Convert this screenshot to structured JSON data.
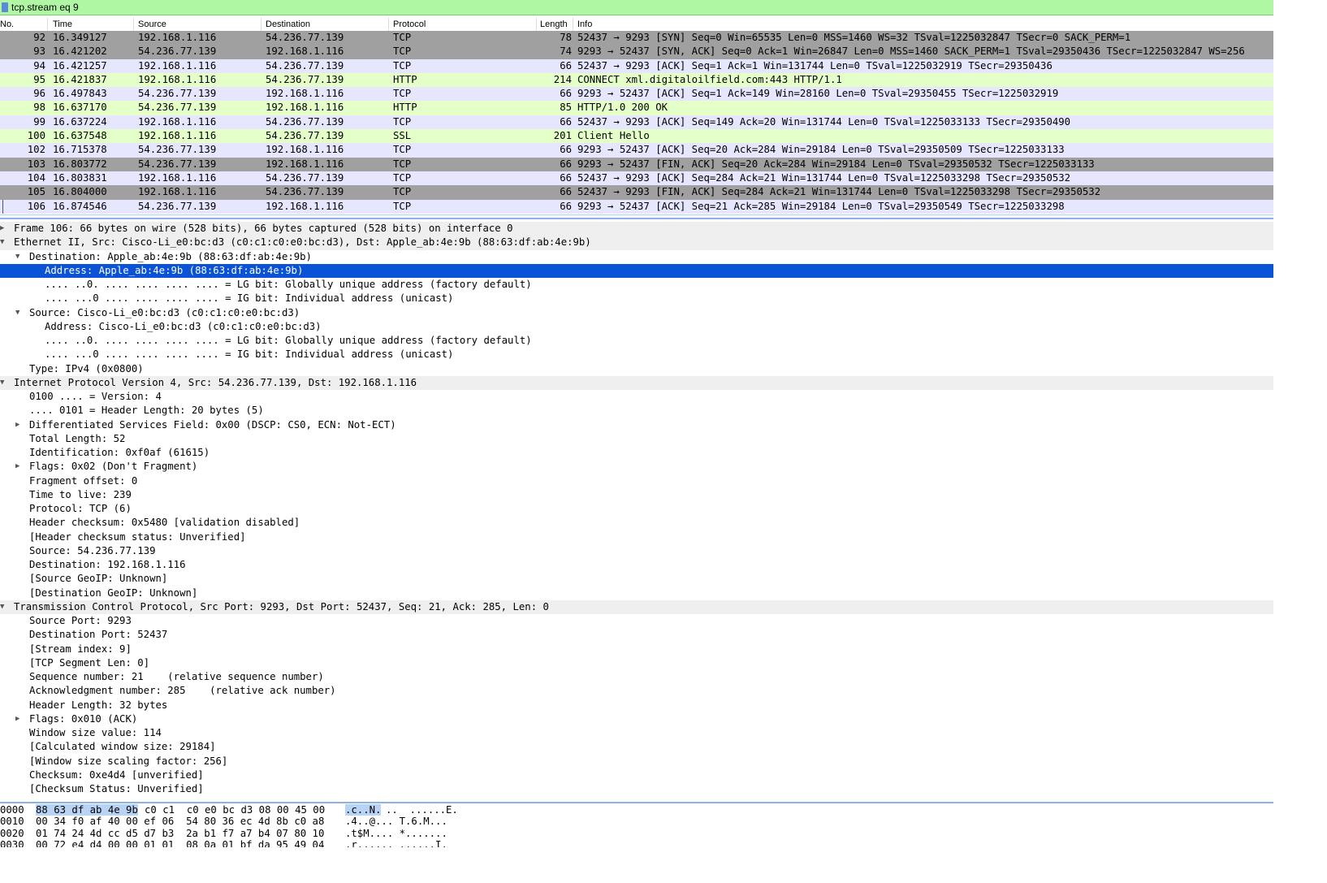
{
  "filter": {
    "value": "tcp.stream eq 9"
  },
  "columns": {
    "no": "No.",
    "time": "Time",
    "source": "Source",
    "destination": "Destination",
    "protocol": "Protocol",
    "length": "Length",
    "info": "Info"
  },
  "colors": {
    "tcp_row": "#e7e6ff",
    "http_row": "#e4ffc7",
    "ssl_row": "#e7e6ff",
    "fin_syn_row": "#a0a0a0",
    "selected": "#0a53d6",
    "filter_bg": "#aff7a3"
  },
  "packets": [
    {
      "no": "92",
      "time": "16.349127",
      "src": "192.168.1.116",
      "dst": "54.236.77.139",
      "proto": "TCP",
      "len": "78",
      "info": "52437 → 9293 [SYN] Seq=0 Win=65535 Len=0 MSS=1460 WS=32 TSval=1225032847 TSecr=0 SACK_PERM=1",
      "color": "#a0a0a0"
    },
    {
      "no": "93",
      "time": "16.421202",
      "src": "54.236.77.139",
      "dst": "192.168.1.116",
      "proto": "TCP",
      "len": "74",
      "info": "9293 → 52437 [SYN, ACK] Seq=0 Ack=1 Win=26847 Len=0 MSS=1460 SACK_PERM=1 TSval=29350436 TSecr=1225032847 WS=256",
      "color": "#a0a0a0"
    },
    {
      "no": "94",
      "time": "16.421257",
      "src": "192.168.1.116",
      "dst": "54.236.77.139",
      "proto": "TCP",
      "len": "66",
      "info": "52437 → 9293 [ACK] Seq=1 Ack=1 Win=131744 Len=0 TSval=1225032919 TSecr=29350436",
      "color": "#e7e6ff"
    },
    {
      "no": "95",
      "time": "16.421837",
      "src": "192.168.1.116",
      "dst": "54.236.77.139",
      "proto": "HTTP",
      "len": "214",
      "info": "CONNECT xml.digitaloilfield.com:443 HTTP/1.1",
      "color": "#e4ffc7"
    },
    {
      "no": "96",
      "time": "16.497843",
      "src": "54.236.77.139",
      "dst": "192.168.1.116",
      "proto": "TCP",
      "len": "66",
      "info": "9293 → 52437 [ACK] Seq=1 Ack=149 Win=28160 Len=0 TSval=29350455 TSecr=1225032919",
      "color": "#e7e6ff"
    },
    {
      "no": "98",
      "time": "16.637170",
      "src": "54.236.77.139",
      "dst": "192.168.1.116",
      "proto": "HTTP",
      "len": "85",
      "info": "HTTP/1.0 200 OK",
      "color": "#e4ffc7"
    },
    {
      "no": "99",
      "time": "16.637224",
      "src": "192.168.1.116",
      "dst": "54.236.77.139",
      "proto": "TCP",
      "len": "66",
      "info": "52437 → 9293 [ACK] Seq=149 Ack=20 Win=131744 Len=0 TSval=1225033133 TSecr=29350490",
      "color": "#e7e6ff"
    },
    {
      "no": "100",
      "time": "16.637548",
      "src": "192.168.1.116",
      "dst": "54.236.77.139",
      "proto": "SSL",
      "len": "201",
      "info": "Client Hello",
      "color": "#e4ffc7"
    },
    {
      "no": "102",
      "time": "16.715378",
      "src": "54.236.77.139",
      "dst": "192.168.1.116",
      "proto": "TCP",
      "len": "66",
      "info": "9293 → 52437 [ACK] Seq=20 Ack=284 Win=29184 Len=0 TSval=29350509 TSecr=1225033133",
      "color": "#e7e6ff"
    },
    {
      "no": "103",
      "time": "16.803772",
      "src": "54.236.77.139",
      "dst": "192.168.1.116",
      "proto": "TCP",
      "len": "66",
      "info": "9293 → 52437 [FIN, ACK] Seq=20 Ack=284 Win=29184 Len=0 TSval=29350532 TSecr=1225033133",
      "color": "#a0a0a0"
    },
    {
      "no": "104",
      "time": "16.803831",
      "src": "192.168.1.116",
      "dst": "54.236.77.139",
      "proto": "TCP",
      "len": "66",
      "info": "52437 → 9293 [ACK] Seq=284 Ack=21 Win=131744 Len=0 TSval=1225033298 TSecr=29350532",
      "color": "#e7e6ff"
    },
    {
      "no": "105",
      "time": "16.804000",
      "src": "192.168.1.116",
      "dst": "54.236.77.139",
      "proto": "TCP",
      "len": "66",
      "info": "52437 → 9293 [FIN, ACK] Seq=284 Ack=21 Win=131744 Len=0 TSval=1225033298 TSecr=29350532",
      "color": "#a0a0a0"
    },
    {
      "no": "106",
      "time": "16.874546",
      "src": "54.236.77.139",
      "dst": "192.168.1.116",
      "proto": "TCP",
      "len": "66",
      "info": "9293 → 52437 [ACK] Seq=21 Ack=285 Win=29184 Len=0 TSval=29350549 TSecr=1225033298",
      "color": "#e7e6ff"
    }
  ],
  "details": [
    {
      "level": 0,
      "expander": "collapsed",
      "text": "Frame 106: 66 bytes on wire (528 bits), 66 bytes captured (528 bits) on interface 0"
    },
    {
      "level": 0,
      "expander": "expanded",
      "text": "Ethernet II, Src: Cisco-Li_e0:bc:d3 (c0:c1:c0:e0:bc:d3), Dst: Apple_ab:4e:9b (88:63:df:ab:4e:9b)"
    },
    {
      "level": 1,
      "expander": "expanded",
      "text": "Destination: Apple_ab:4e:9b (88:63:df:ab:4e:9b)"
    },
    {
      "level": 2,
      "expander": "none",
      "selected": true,
      "text": "Address: Apple_ab:4e:9b (88:63:df:ab:4e:9b)"
    },
    {
      "level": 2,
      "expander": "none",
      "text": ".... ..0. .... .... .... .... = LG bit: Globally unique address (factory default)"
    },
    {
      "level": 2,
      "expander": "none",
      "text": ".... ...0 .... .... .... .... = IG bit: Individual address (unicast)"
    },
    {
      "level": 1,
      "expander": "expanded",
      "text": "Source: Cisco-Li_e0:bc:d3 (c0:c1:c0:e0:bc:d3)"
    },
    {
      "level": 2,
      "expander": "none",
      "text": "Address: Cisco-Li_e0:bc:d3 (c0:c1:c0:e0:bc:d3)"
    },
    {
      "level": 2,
      "expander": "none",
      "text": ".... ..0. .... .... .... .... = LG bit: Globally unique address (factory default)"
    },
    {
      "level": 2,
      "expander": "none",
      "text": ".... ...0 .... .... .... .... = IG bit: Individual address (unicast)"
    },
    {
      "level": 1,
      "expander": "none",
      "text": "Type: IPv4 (0x0800)"
    },
    {
      "level": 0,
      "expander": "expanded",
      "text": "Internet Protocol Version 4, Src: 54.236.77.139, Dst: 192.168.1.116"
    },
    {
      "level": 1,
      "expander": "none",
      "text": "0100 .... = Version: 4"
    },
    {
      "level": 1,
      "expander": "none",
      "text": ".... 0101 = Header Length: 20 bytes (5)"
    },
    {
      "level": 1,
      "expander": "collapsed",
      "text": "Differentiated Services Field: 0x00 (DSCP: CS0, ECN: Not-ECT)"
    },
    {
      "level": 1,
      "expander": "none",
      "text": "Total Length: 52"
    },
    {
      "level": 1,
      "expander": "none",
      "text": "Identification: 0xf0af (61615)"
    },
    {
      "level": 1,
      "expander": "collapsed",
      "text": "Flags: 0x02 (Don't Fragment)"
    },
    {
      "level": 1,
      "expander": "none",
      "text": "Fragment offset: 0"
    },
    {
      "level": 1,
      "expander": "none",
      "text": "Time to live: 239"
    },
    {
      "level": 1,
      "expander": "none",
      "text": "Protocol: TCP (6)"
    },
    {
      "level": 1,
      "expander": "none",
      "text": "Header checksum: 0x5480 [validation disabled]"
    },
    {
      "level": 1,
      "expander": "none",
      "text": "[Header checksum status: Unverified]"
    },
    {
      "level": 1,
      "expander": "none",
      "text": "Source: 54.236.77.139"
    },
    {
      "level": 1,
      "expander": "none",
      "text": "Destination: 192.168.1.116"
    },
    {
      "level": 1,
      "expander": "none",
      "text": "[Source GeoIP: Unknown]"
    },
    {
      "level": 1,
      "expander": "none",
      "text": "[Destination GeoIP: Unknown]"
    },
    {
      "level": 0,
      "expander": "expanded",
      "text": "Transmission Control Protocol, Src Port: 9293, Dst Port: 52437, Seq: 21, Ack: 285, Len: 0"
    },
    {
      "level": 1,
      "expander": "none",
      "text": "Source Port: 9293"
    },
    {
      "level": 1,
      "expander": "none",
      "text": "Destination Port: 52437"
    },
    {
      "level": 1,
      "expander": "none",
      "text": "[Stream index: 9]"
    },
    {
      "level": 1,
      "expander": "none",
      "text": "[TCP Segment Len: 0]"
    },
    {
      "level": 1,
      "expander": "none",
      "text": "Sequence number: 21    (relative sequence number)"
    },
    {
      "level": 1,
      "expander": "none",
      "text": "Acknowledgment number: 285    (relative ack number)"
    },
    {
      "level": 1,
      "expander": "none",
      "text": "Header Length: 32 bytes"
    },
    {
      "level": 1,
      "expander": "collapsed",
      "text": "Flags: 0x010 (ACK)"
    },
    {
      "level": 1,
      "expander": "none",
      "text": "Window size value: 114"
    },
    {
      "level": 1,
      "expander": "none",
      "text": "[Calculated window size: 29184]"
    },
    {
      "level": 1,
      "expander": "none",
      "text": "[Window size scaling factor: 256]"
    },
    {
      "level": 1,
      "expander": "none",
      "text": "Checksum: 0xe4d4 [unverified]"
    },
    {
      "level": 1,
      "expander": "none",
      "text": "[Checksum Status: Unverified]"
    }
  ],
  "hex": [
    {
      "offset": "0000",
      "sel": "88 63 df ab 4e 9b",
      "rest": "c0 c1  c0 e0 bc d3 08 00 45 00",
      "ascii_sel": ".c..N.",
      "ascii_rest": "..  ......E."
    },
    {
      "offset": "0010",
      "sel": "",
      "rest": "",
      "full": "00 34 f0 af 40 00 ef 06  54 80 36 ec 4d 8b c0 a8",
      "ascii_full": ".4..@... T.6.M..."
    },
    {
      "offset": "0020",
      "sel": "",
      "rest": "",
      "full": "01 74 24 4d cc d5 d7 b3  2a b1 f7 a7 b4 07 80 10",
      "ascii_full": ".t$M.... *......."
    },
    {
      "offset": "0030",
      "sel": "",
      "rest": "",
      "full": "00 72 e4 d4 00 00 01 01  08 0a 01 bf da 95 49 04",
      "ascii_full": ".r...... ......I."
    }
  ]
}
